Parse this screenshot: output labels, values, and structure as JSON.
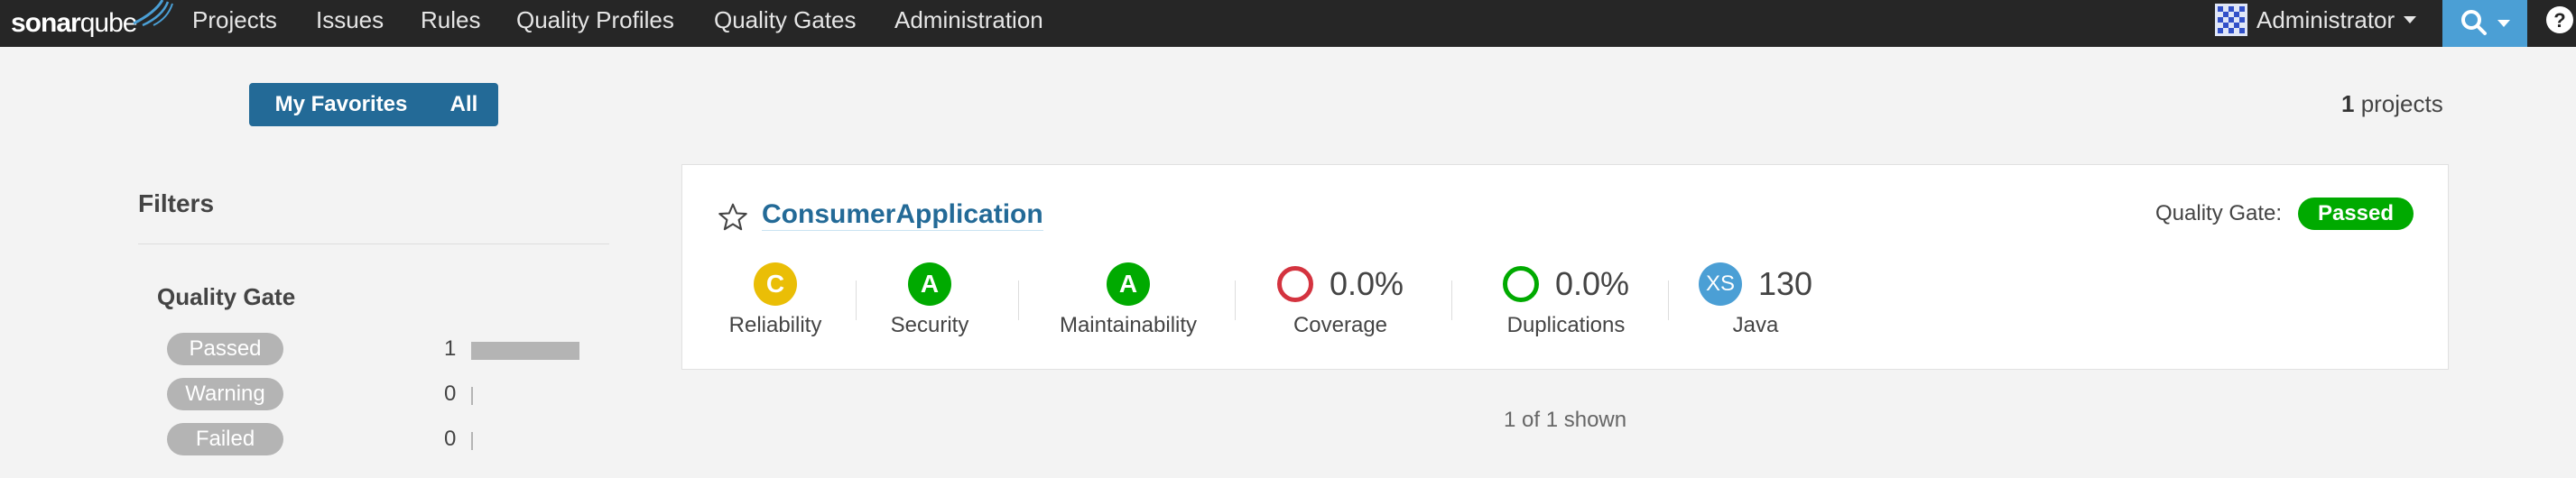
{
  "navbar": {
    "logo": {
      "part1": "sonar",
      "part2": "qube"
    },
    "items": [
      "Projects",
      "Issues",
      "Rules",
      "Quality Profiles",
      "Quality Gates",
      "Administration"
    ],
    "user": "Administrator",
    "search_icon": "search-icon",
    "help_label": "?"
  },
  "favorites": {
    "my": "My Favorites",
    "all": "All",
    "selected": "All"
  },
  "projects_count": {
    "number": "1",
    "label": " projects"
  },
  "filters": {
    "title": "Filters",
    "quality_gate": {
      "title": "Quality Gate",
      "facets": [
        {
          "label": "Passed",
          "count": "1",
          "fraction": 1.0
        },
        {
          "label": "Warning",
          "count": "0",
          "fraction": 0
        },
        {
          "label": "Failed",
          "count": "0",
          "fraction": 0
        }
      ]
    }
  },
  "project": {
    "name": "ConsumerApplication",
    "quality_gate_label": "Quality Gate:",
    "quality_gate_status": "Passed",
    "measures": {
      "reliability": {
        "rating": "C",
        "label": "Reliability",
        "color": "#eabe06"
      },
      "security": {
        "rating": "A",
        "label": "Security",
        "color": "#00aa00"
      },
      "maintainability": {
        "rating": "A",
        "label": "Maintainability",
        "color": "#00aa00"
      },
      "coverage": {
        "value": "0.0%",
        "label": "Coverage",
        "color": "#d4333f"
      },
      "duplications": {
        "value": "0.0%",
        "label": "Duplications",
        "color": "#00aa00"
      },
      "size": {
        "badge": "XS",
        "value": "130",
        "label": "Java",
        "color": "#4b9fd5"
      }
    }
  },
  "pagination": {
    "shown": "1 of 1 shown"
  }
}
